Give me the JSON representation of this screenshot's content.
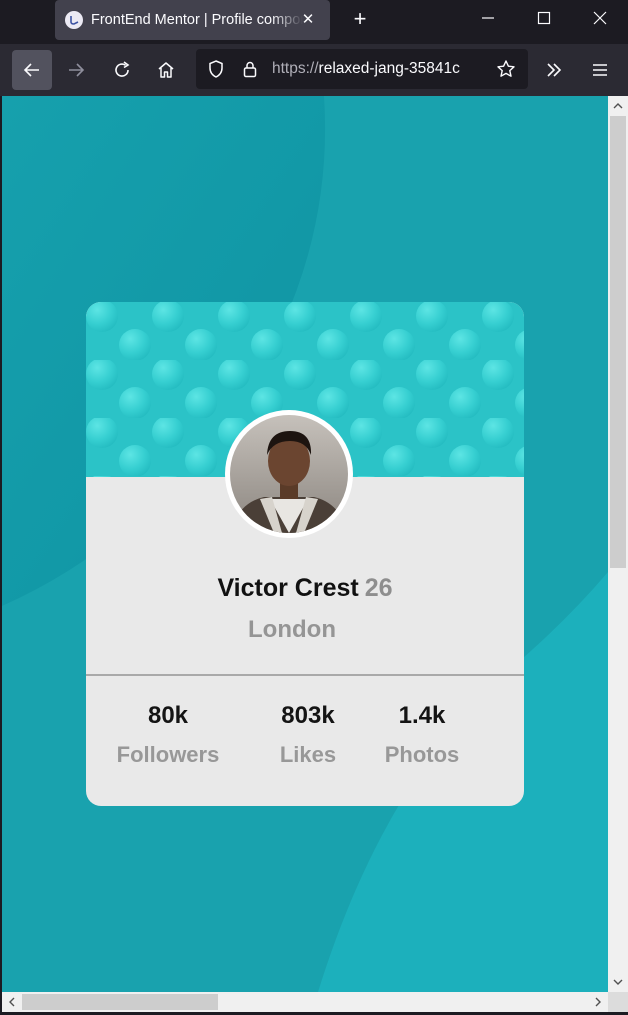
{
  "browser": {
    "tab_title": "FrontEnd Mentor | Profile component",
    "url_scheme": "https://",
    "url_rest": "relaxed-jang-35841c"
  },
  "profile": {
    "name": "Victor Crest",
    "age": "26",
    "city": "London"
  },
  "stats": [
    {
      "value": "80k",
      "label": "Followers"
    },
    {
      "value": "803k",
      "label": "Likes"
    },
    {
      "value": "1.4k",
      "label": "Photos"
    }
  ],
  "colors": {
    "background": "#19a2ae",
    "card": "#e9e9e9",
    "accent_pattern": "#2bc6cb",
    "text_dark": "#111111",
    "text_grey": "#959595"
  },
  "icons": [
    "back-icon",
    "forward-icon",
    "reload-icon",
    "home-icon",
    "shield-icon",
    "lock-icon",
    "star-icon",
    "overflow-icon",
    "menu-icon"
  ]
}
